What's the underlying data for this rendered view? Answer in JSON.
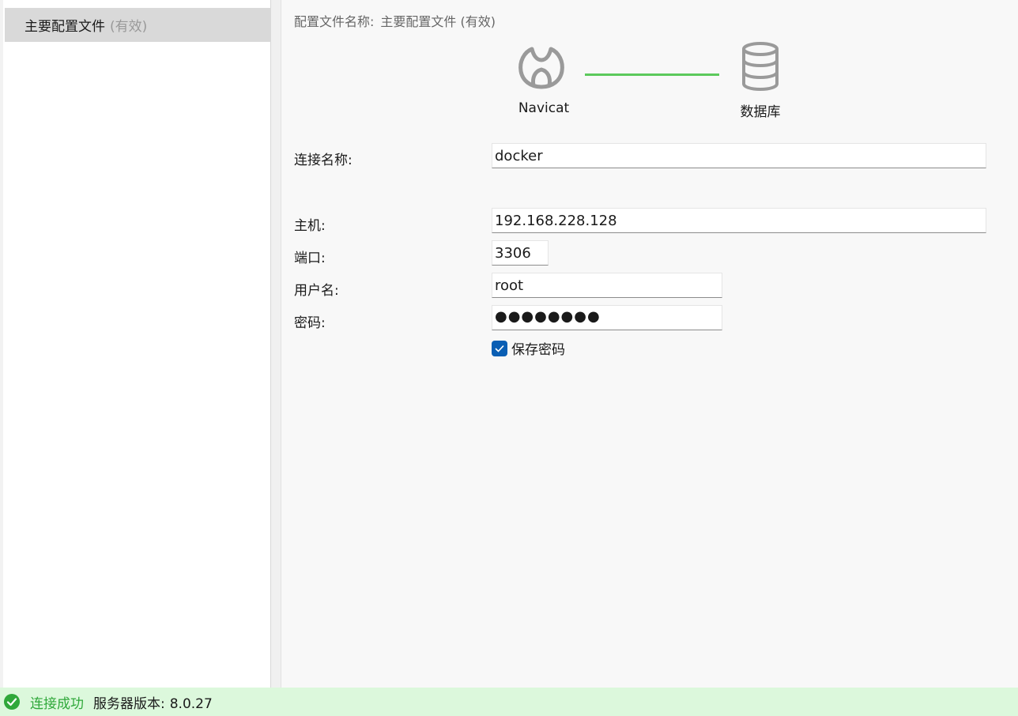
{
  "sidebar": {
    "items": [
      {
        "label": "主要配置文件",
        "state": "(有效)"
      }
    ]
  },
  "main": {
    "profile_name_label": "配置文件名称:",
    "profile_name_value": "主要配置文件 (有效)",
    "diagram": {
      "client_label": "Navicat",
      "server_label": "数据库",
      "link_color": "#5cc95c"
    },
    "form": {
      "connection_name": {
        "label": "连接名称:",
        "value": "docker"
      },
      "host": {
        "label": "主机:",
        "value": "192.168.228.128"
      },
      "port": {
        "label": "端口:",
        "value": "3306"
      },
      "username": {
        "label": "用户名:",
        "value": "root"
      },
      "password": {
        "label": "密码:",
        "masked": "●●●●●●●●"
      },
      "save_password": {
        "label": "保存密码",
        "checked": true
      }
    }
  },
  "status": {
    "icon": "check-circle-icon",
    "success_text": "连接成功",
    "version_label": "服务器版本:",
    "version_value": "8.0.27",
    "success_color": "#2fa83a"
  }
}
